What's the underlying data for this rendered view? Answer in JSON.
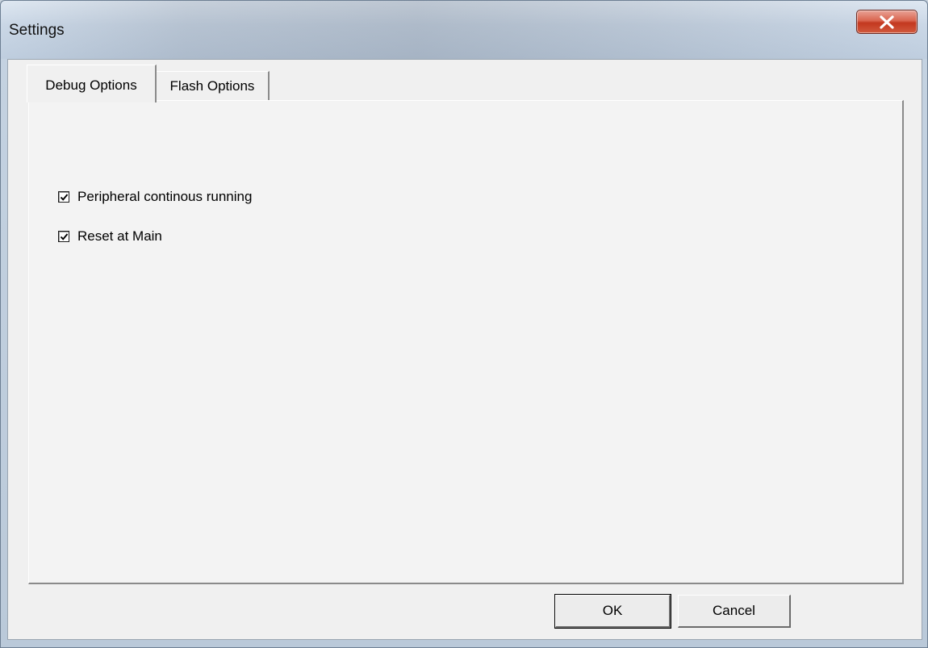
{
  "window": {
    "title": "Settings",
    "close_label": "X"
  },
  "tabs": [
    {
      "label": "Debug Options",
      "selected": true
    },
    {
      "label": "Flash Options",
      "selected": false
    }
  ],
  "debug_options": {
    "checkboxes": [
      {
        "label": "Peripheral continous running",
        "checked": true
      },
      {
        "label": "Reset at Main",
        "checked": true
      }
    ]
  },
  "buttons": {
    "ok_label": "OK",
    "cancel_label": "Cancel"
  },
  "colors": {
    "close_button": "#c3381f",
    "dialog_face": "#f0f0f0"
  }
}
